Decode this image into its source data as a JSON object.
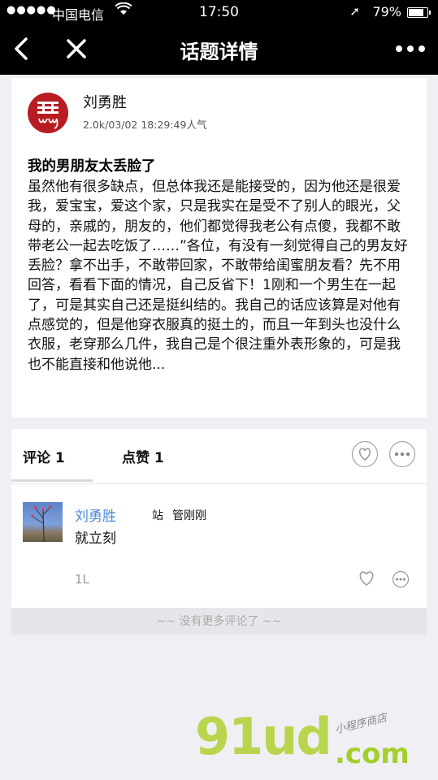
{
  "status_bar": {
    "signal": "●●●●●",
    "carrier": "中国电信",
    "time": "17:50",
    "battery": "79%"
  },
  "nav": {
    "title": "话题详情"
  },
  "post": {
    "author": "刘勇胜",
    "meta": "2.0k/03/02 18:29:49人气",
    "title": "我的男朋友太丢脸了",
    "body": "虽然他有很多缺点，但总体我还是能接受的，因为他还是很爱我，爱宝宝，爱这个家，只是我实在是受不了别人的眼光，父母的，亲戚的，朋友的，他们都觉得我老公有点傻，我都不敢带老公一起去吃饭了……”各位，有没有一刻觉得自己的男友好丢脸？拿不出手，不敢带回家，不敢带给闺蜜朋友看？先不用回答，看看下面的情况，自己反省下！1刚和一个男生在一起了，可是其实自己还是挺纠结的。我自己的话应该算是对他有点感觉的，但是他穿衣服真的挺土的，而且一年到头也没什么衣服，老穿那么几件，我自己是个很注重外表形象的，可是我也不能直接和他说他..."
  },
  "tabs": {
    "comments": "评论 1",
    "likes": "点赞 1"
  },
  "comment": {
    "name": "刘勇胜",
    "reply_word": "站",
    "reply_target": "管刚刚",
    "text": "就立刻",
    "floor": "1L"
  },
  "footer": {
    "no_more": "~~ 没有更多评论了 ~~"
  },
  "watermark": {
    "main": "91ud",
    "domain": ".com",
    "tagline": "小程序商店"
  }
}
